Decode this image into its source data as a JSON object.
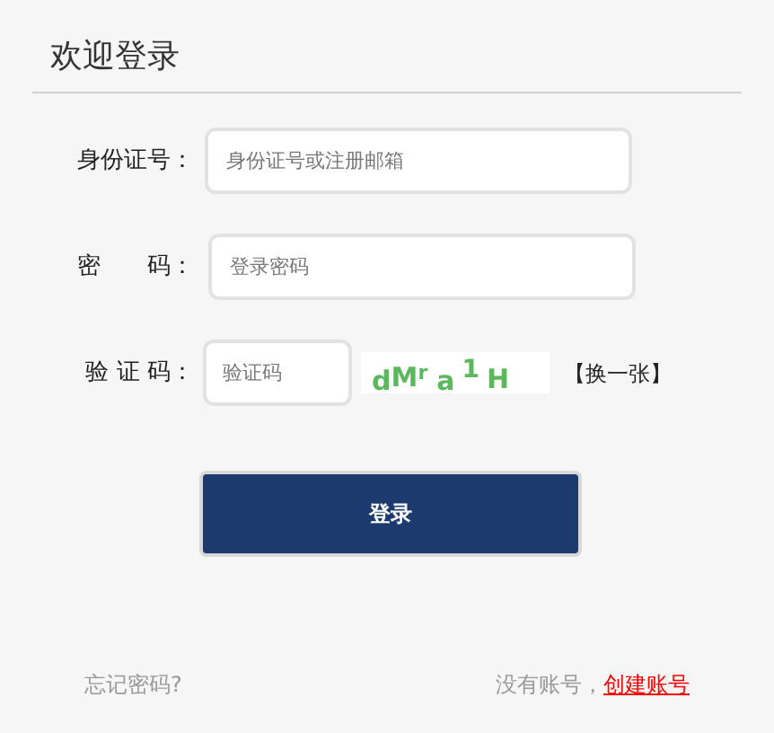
{
  "title": "欢迎登录",
  "fields": [
    {
      "label": "身份证号：",
      "placeholder": "身份证号或注册邮箱"
    },
    {
      "label": "密　　码：",
      "placeholder": "登录密码"
    }
  ],
  "captcha": {
    "label": "验 证 码：",
    "placeholder": "验证码",
    "chars": [
      "d",
      "M",
      "r",
      "a",
      "1",
      "H"
    ],
    "refresh": "【换一张】"
  },
  "login_button": "登录",
  "footer": {
    "forgot": "忘记密码?",
    "no_account": "没有账号，",
    "create": "创建账号"
  }
}
